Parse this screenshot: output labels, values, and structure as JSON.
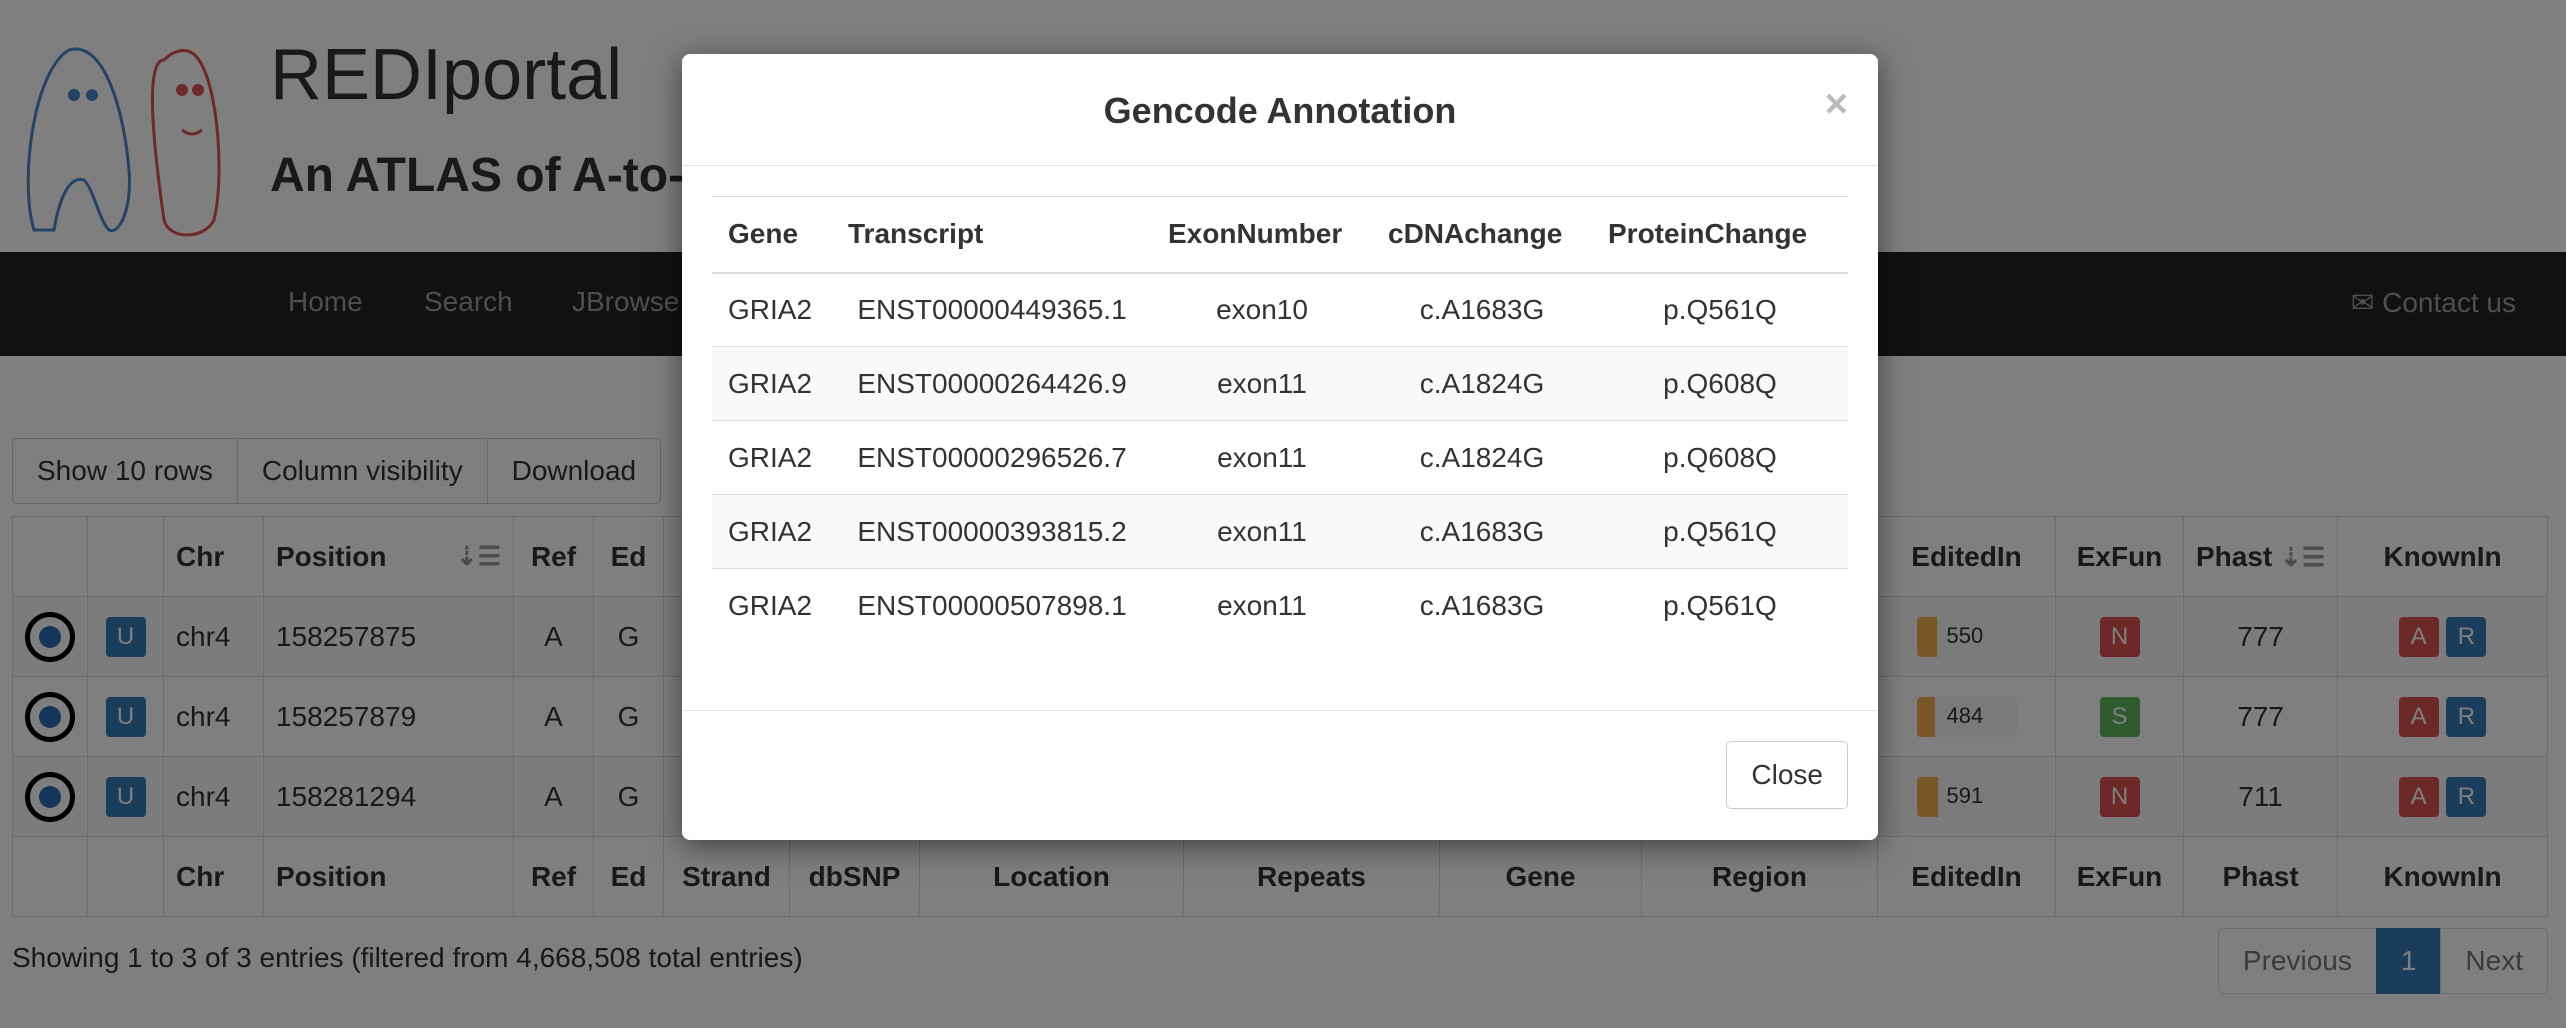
{
  "site": {
    "title": "REDIportal",
    "subtitle": "An ATLAS of A-to-I RNA editing events in humans"
  },
  "nav": {
    "items": [
      "Home",
      "Search",
      "JBrowse"
    ],
    "contact": "Contact us",
    "contact_icon": "envelope-icon"
  },
  "toolbar": {
    "show_rows": "Show 10 rows",
    "column_visibility": "Column visibility",
    "download": "Download"
  },
  "table": {
    "columns": [
      "",
      "",
      "Chr",
      "Position",
      "Ref",
      "Ed",
      "Strand",
      "dbSNP",
      "Location",
      "Repeats",
      "Gene",
      "Region",
      "EditedIn",
      "ExFun",
      "Phast",
      "KnownIn"
    ],
    "rows": [
      {
        "chr": "chr4",
        "position": "158257875",
        "ref": "A",
        "ed": "G",
        "edited_in": "550",
        "edited_in_fraction": 0.2,
        "exfun": "N",
        "phast": "777",
        "known_a": "A",
        "known_r": "R"
      },
      {
        "chr": "chr4",
        "position": "158257879",
        "ref": "A",
        "ed": "G",
        "edited_in": "484",
        "edited_in_fraction": 0.18,
        "exfun": "S",
        "phast": "777",
        "known_a": "A",
        "known_r": "R"
      },
      {
        "chr": "chr4",
        "position": "158281294",
        "ref": "A",
        "ed": "G",
        "edited_in": "591",
        "edited_in_fraction": 0.21,
        "exfun": "N",
        "phast": "711",
        "known_a": "A",
        "known_r": "R"
      }
    ],
    "u_label": "U"
  },
  "footer": {
    "info": "Showing 1 to 3 of 3 entries (filtered from 4,668,508 total entries)",
    "prev": "Previous",
    "page": "1",
    "next": "Next"
  },
  "modal": {
    "title": "Gencode Annotation",
    "close_x": "×",
    "close_button": "Close",
    "columns": [
      "Gene",
      "Transcript",
      "ExonNumber",
      "cDNAchange",
      "ProteinChange"
    ],
    "rows": [
      [
        "GRIA2",
        "ENST00000449365.1",
        "exon10",
        "c.A1683G",
        "p.Q561Q"
      ],
      [
        "GRIA2",
        "ENST00000264426.9",
        "exon11",
        "c.A1824G",
        "p.Q608Q"
      ],
      [
        "GRIA2",
        "ENST00000296526.7",
        "exon11",
        "c.A1824G",
        "p.Q608Q"
      ],
      [
        "GRIA2",
        "ENST00000393815.2",
        "exon11",
        "c.A1683G",
        "p.Q561Q"
      ],
      [
        "GRIA2",
        "ENST00000507898.1",
        "exon11",
        "c.A1683G",
        "p.Q561Q"
      ]
    ]
  }
}
